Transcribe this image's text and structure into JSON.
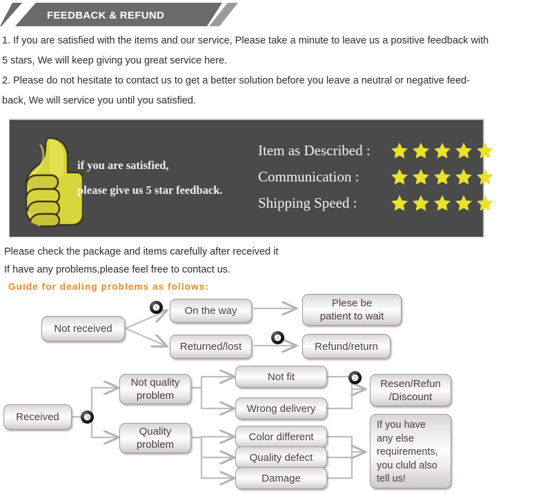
{
  "header": {
    "title": "FEEDBACK & REFUND",
    "bar_color": "#6a6a6a",
    "text_color": "#ffffff"
  },
  "intro": {
    "lines": [
      "1. If you are satisfied with the items and our service, Please take a minute to leave us a positive feedback with",
      "5 stars, We will keep giving you great service here.",
      "2. Please do not hesitate to contact us to get a better solution before you leave a neutral or negative feed-",
      "back, We will service you until you satisfied."
    ]
  },
  "feedback_banner": {
    "background": "#4a4a4a",
    "thumb_icon": "thumbs-up-icon",
    "thumb_color": "#d8d536",
    "left_text": [
      "if you are satisfied,",
      "please give us 5 star feedback."
    ],
    "star_color": "#e8e229",
    "ratings": [
      {
        "label": "Item as Described :",
        "stars": 5
      },
      {
        "label": "Communication :",
        "stars": 5
      },
      {
        "label": "Shipping Speed :",
        "stars": 5
      }
    ]
  },
  "mid_text": {
    "lines": [
      "Please check the package and items carefully after received it",
      "If have any problems,please feel free to contact us."
    ],
    "guide": "Guide for dealing problems as follows:",
    "guide_color": "#ef8a21"
  },
  "flowchart": {
    "boxes": {
      "not_received": "Not received",
      "on_the_way": "On the way",
      "returned_lost": "Returned/lost",
      "plese_be_patient": "Plese be\npatient to wait",
      "refund_return": "Refund/return",
      "received": "Received",
      "not_quality_problem": "Not quality\nproblem",
      "quality_problem": "Quality\nproblem",
      "not_fit": "Not fit",
      "wrong_delivery": "Wrong delivery",
      "color_different": "Color different",
      "quality_defect": "Quality defect",
      "damage": "Damage",
      "resend_refund_discount": "Resen/Refun\n/Discount",
      "any_else": "If you have\nany else\nrequirements,\nyou cluld also\ntell us!"
    },
    "badges": {
      "one": "❶",
      "two": "❷",
      "three": "❸"
    }
  }
}
